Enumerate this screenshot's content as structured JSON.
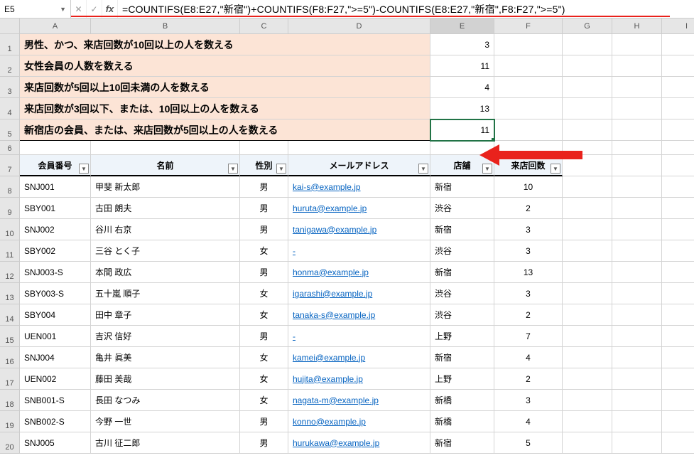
{
  "activeCell": "E5",
  "formula": "=COUNTIFS(E8:E27,\"新宿\")+COUNTIFS(F8:F27,\">=5\")-COUNTIFS(E8:E27,\"新宿\",F8:F27,\">=5\")",
  "columns": [
    "A",
    "B",
    "C",
    "D",
    "E",
    "F",
    "G",
    "H",
    "I"
  ],
  "rowNums": [
    1,
    2,
    3,
    4,
    5,
    6,
    7,
    8,
    9,
    10,
    11,
    12,
    13,
    14,
    15,
    16,
    17,
    18,
    19,
    20
  ],
  "summary": [
    {
      "label": "男性、かつ、来店回数が10回以上の人を数える",
      "value": 3
    },
    {
      "label": "女性会員の人数を数える",
      "value": 11
    },
    {
      "label": "来店回数が5回以上10回未満の人を数える",
      "value": 4
    },
    {
      "label": "来店回数が3回以下、または、10回以上の人を数える",
      "value": 13
    },
    {
      "label": "新宿店の会員、または、来店回数が5回以上の人を数える",
      "value": 11
    }
  ],
  "tableHeaders": {
    "id": "会員番号",
    "name": "名前",
    "gender": "性別",
    "email": "メールアドレス",
    "store": "店舗",
    "visits": "来店回数"
  },
  "members": [
    {
      "id": "SNJ001",
      "name": "甲斐 新太郎",
      "gender": "男",
      "email": "kai-s@example.jp",
      "store": "新宿",
      "visits": 10
    },
    {
      "id": "SBY001",
      "name": "古田 朗夫",
      "gender": "男",
      "email": "huruta@example.jp",
      "store": "渋谷",
      "visits": 2
    },
    {
      "id": "SNJ002",
      "name": "谷川 右京",
      "gender": "男",
      "email": "tanigawa@example.jp",
      "store": "新宿",
      "visits": 3
    },
    {
      "id": "SBY002",
      "name": "三谷 とく子",
      "gender": "女",
      "email": "-",
      "store": "渋谷",
      "visits": 3
    },
    {
      "id": "SNJ003-S",
      "name": "本間 政広",
      "gender": "男",
      "email": "honma@example.jp",
      "store": "新宿",
      "visits": 13
    },
    {
      "id": "SBY003-S",
      "name": "五十嵐 順子",
      "gender": "女",
      "email": "igarashi@example.jp",
      "store": "渋谷",
      "visits": 3
    },
    {
      "id": "SBY004",
      "name": "田中 章子",
      "gender": "女",
      "email": "tanaka-s@example.jp",
      "store": "渋谷",
      "visits": 2
    },
    {
      "id": "UEN001",
      "name": "吉沢 信好",
      "gender": "男",
      "email": "-",
      "store": "上野",
      "visits": 7
    },
    {
      "id": "SNJ004",
      "name": "亀井 眞美",
      "gender": "女",
      "email": "kamei@example.jp",
      "store": "新宿",
      "visits": 4
    },
    {
      "id": "UEN002",
      "name": "藤田 美哉",
      "gender": "女",
      "email": "hujita@example.jp",
      "store": "上野",
      "visits": 2
    },
    {
      "id": "SNB001-S",
      "name": "長田 なつみ",
      "gender": "女",
      "email": "nagata-m@example.jp",
      "store": "新橋",
      "visits": 3
    },
    {
      "id": "SNB002-S",
      "name": "今野 一世",
      "gender": "男",
      "email": "konno@example.jp",
      "store": "新橋",
      "visits": 4
    },
    {
      "id": "SNJ005",
      "name": "古川 征二郎",
      "gender": "男",
      "email": "hurukawa@example.jp",
      "store": "新宿",
      "visits": 5
    }
  ]
}
